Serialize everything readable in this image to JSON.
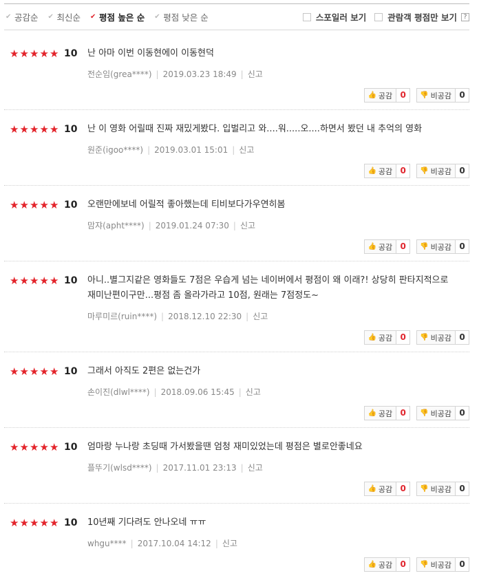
{
  "sort_options": [
    {
      "label": "공감순",
      "active": false
    },
    {
      "label": "최신순",
      "active": false
    },
    {
      "label": "평점 높은 순",
      "active": true
    },
    {
      "label": "평점 낮은 순",
      "active": false
    }
  ],
  "filters": {
    "spoiler": "스포일러 보기",
    "audience": "관람객 평점만 보기",
    "help": "?"
  },
  "colors": {
    "star": "#e3242b",
    "active_check": "#e0262e"
  },
  "labels": {
    "like": "공감",
    "dislike": "비공감",
    "report": "신고"
  },
  "reviews": [
    {
      "score": "10",
      "text": "난 아마 이번 이동현에이 이동현덕",
      "author": "전순임(grea****)",
      "date": "2019.03.23 18:49",
      "likes": "0",
      "dislikes": "0"
    },
    {
      "score": "10",
      "text": "난 이 영화 어릴때 진짜 재밌게봤다. 입벌리고 와....워.....오....하면서 봤던 내 추억의 영화",
      "author": "원준(igoo****)",
      "date": "2019.03.01 15:01",
      "likes": "0",
      "dislikes": "0"
    },
    {
      "score": "10",
      "text": "오랜만에보네 어릴적 좋아했는데 티비보다가우연히봄",
      "author": "맘쟈(apht****)",
      "date": "2019.01.24 07:30",
      "likes": "0",
      "dislikes": "0"
    },
    {
      "score": "10",
      "text": "아니..별그지같은 영화들도 7점은 우습게 넘는 네이버에서 평점이 왜 이래?! 상당히 판타지적으로 재미난편이구만...평점 좀 올라가라고 10점, 원래는 7점정도~",
      "author": "마루미르(ruin****)",
      "date": "2018.12.10 22:30",
      "likes": "0",
      "dislikes": "0"
    },
    {
      "score": "10",
      "text": "그래서 아직도 2편은 없는건가",
      "author": "손이진(dlwl****)",
      "date": "2018.09.06 15:45",
      "likes": "0",
      "dislikes": "0"
    },
    {
      "score": "10",
      "text": "엄마랑 누나랑 초딩때 가서봤을땐 엄청 재미있었는데 평점은 별로안좋네요",
      "author": "플뚜기(wlsd****)",
      "date": "2017.11.01 23:13",
      "likes": "0",
      "dislikes": "0"
    },
    {
      "score": "10",
      "text": "10년째 기다려도 안나오네 ㅠㅠ",
      "author": "whgu****",
      "date": "2017.10.04 14:12",
      "likes": "0",
      "dislikes": "0"
    }
  ]
}
